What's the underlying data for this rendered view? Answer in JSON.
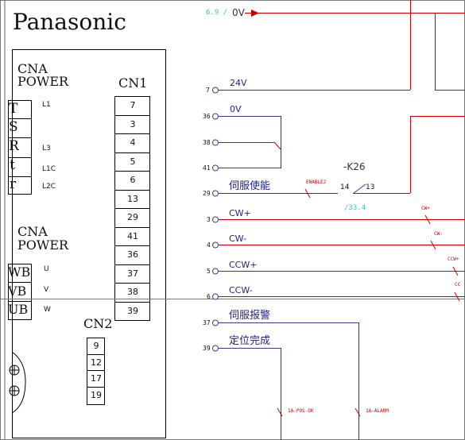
{
  "brand": "Panasonic",
  "cna_power_top": {
    "line1": "CNA",
    "line2": "POWER"
  },
  "cna_power_bottom": {
    "line1": "CNA",
    "line2": "POWER"
  },
  "cn1": {
    "label": "CN1",
    "pins": [
      "7",
      "3",
      "4",
      "5",
      "6",
      "13",
      "29",
      "41",
      "36",
      "37",
      "38",
      "39"
    ]
  },
  "cn2": {
    "label": "CN2",
    "pins": [
      "9",
      "12",
      "17",
      "19"
    ]
  },
  "power_terminals": [
    {
      "term": "T",
      "label": "L1"
    },
    {
      "term": "S",
      "label": ""
    },
    {
      "term": "R",
      "label": "L3"
    },
    {
      "term": "t",
      "label": "L1C"
    },
    {
      "term": "r",
      "label": "L2C"
    }
  ],
  "motor_terminals": [
    {
      "term": "WB",
      "label": "U"
    },
    {
      "term": "VB",
      "label": "V"
    },
    {
      "term": "UB",
      "label": "W"
    }
  ],
  "top_ref": {
    "prefix": "6.9 /",
    "net": "0V"
  },
  "signals": [
    {
      "pin": "7",
      "name": "24V"
    },
    {
      "pin": "36",
      "name": "0V"
    },
    {
      "pin": "38",
      "name": ""
    },
    {
      "pin": "41",
      "name": ""
    },
    {
      "pin": "29",
      "name": "伺服使能"
    },
    {
      "pin": "3",
      "name": "CW+"
    },
    {
      "pin": "4",
      "name": "CW-"
    },
    {
      "pin": "5",
      "name": "CCW+"
    },
    {
      "pin": "6",
      "name": "CCW-"
    },
    {
      "pin": "37",
      "name": "伺服报警"
    },
    {
      "pin": "39",
      "name": "定位完成"
    }
  ],
  "relay": {
    "name": "-K26",
    "contact_a": "14",
    "contact_b": "13",
    "ref": "/33.4"
  },
  "wire_tags": {
    "enable": "ENABLE2",
    "cw_plus": "CW+",
    "cw_minus": "CW-",
    "ccw_plus": "CCW+",
    "ccw_minus": "CC",
    "pos_ok": "1A-POS-OK",
    "alarm": "1A-ALARM"
  },
  "colors": {
    "wire": "#cc0000",
    "connector_net": "#3a3a9a",
    "ref_text": "#33c0d0",
    "outline": "#000000"
  }
}
